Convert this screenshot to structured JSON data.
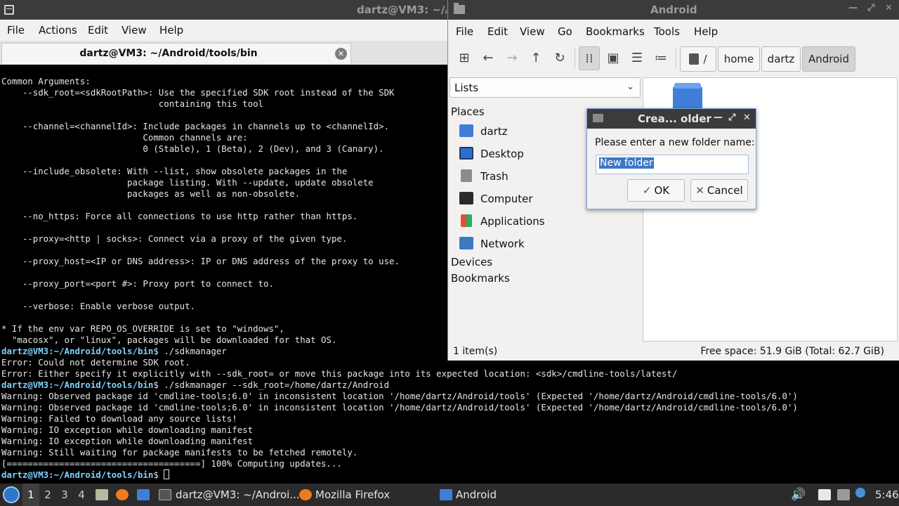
{
  "terminal": {
    "titlebar_title": "dartz@VM3: ~/Android/tools/bin",
    "menu": [
      "File",
      "Actions",
      "Edit",
      "View",
      "Help"
    ],
    "tab_title": "dartz@VM3: ~/Android/tools/bin",
    "prompt_user": "dartz@VM3:",
    "prompt_path": "~/Android/tools/bin",
    "lines_help": [
      "Common Arguments:",
      "    --sdk_root=<sdkRootPath>: Use the specified SDK root instead of the SDK",
      "                              containing this tool",
      "",
      "    --channel=<channelId>: Include packages in channels up to <channelId>.",
      "                           Common channels are:",
      "                           0 (Stable), 1 (Beta), 2 (Dev), and 3 (Canary).",
      "",
      "    --include_obsolete: With --list, show obsolete packages in the",
      "                        package listing. With --update, update obsolete",
      "                        packages as well as non-obsolete.",
      "",
      "    --no_https: Force all connections to use http rather than https.",
      "",
      "    --proxy=<http | socks>: Connect via a proxy of the given type.",
      "",
      "    --proxy_host=<IP or DNS address>: IP or DNS address of the proxy to use.",
      "",
      "    --proxy_port=<port #>: Proxy port to connect to.",
      "",
      "    --verbose: Enable verbose output.",
      "",
      "* If the env var REPO_OS_OVERRIDE is set to \"windows\",",
      "  \"macosx\", or \"linux\", packages will be downloaded for that OS."
    ],
    "cmd1": "$ ./sdkmanager",
    "lines_err": [
      "Error: Could not determine SDK root.",
      "Error: Either specify it explicitly with --sdk_root= or move this package into its expected location: <sdk>/cmdline-tools/latest/"
    ],
    "cmd2": "$ ./sdkmanager --sdk_root=/home/dartz/Android",
    "lines_warn": [
      "Warning: Observed package id 'cmdline-tools;6.0' in inconsistent location '/home/dartz/Android/tools' (Expected '/home/dartz/Android/cmdline-tools/6.0')",
      "Warning: Observed package id 'cmdline-tools;6.0' in inconsistent location '/home/dartz/Android/tools' (Expected '/home/dartz/Android/cmdline-tools/6.0')",
      "Warning: Failed to download any source lists!",
      "Warning: IO exception while downloading manifest",
      "Warning: IO exception while downloading manifest",
      "Warning: Still waiting for package manifests to be fetched remotely.",
      "[=====================================] 100% Computing updates..."
    ],
    "cmd3": "$ "
  },
  "filemanager": {
    "title": "Android",
    "menu": [
      "File",
      "Edit",
      "View",
      "Go",
      "Bookmarks",
      "Tools",
      "Help"
    ],
    "breadcrumbs": [
      "/",
      "home",
      "dartz",
      "Android"
    ],
    "side_combo": "Lists",
    "places_heading": "Places",
    "places": [
      "dartz",
      "Desktop",
      "Trash",
      "Computer",
      "Applications",
      "Network"
    ],
    "devices_heading": "Devices",
    "bookmarks_heading": "Bookmarks",
    "status_left": "1 item(s)",
    "status_right": "Free space: 51.9 GiB (Total: 62.7 GiB)",
    "icon_colors": {
      "folder": "#3f7fd9",
      "home": "#3f7fd9",
      "desktop": "#2c6fd0",
      "trash": "#8c8c8c",
      "computer": "#2a2a2a",
      "network": "#3a7ac0"
    }
  },
  "dialog": {
    "title": "Crea... older",
    "prompt": "Please enter a new folder name:",
    "input_value": "New folder",
    "ok_label": "OK",
    "cancel_label": "Cancel"
  },
  "taskbar": {
    "workspaces": [
      "1",
      "2",
      "3",
      "4"
    ],
    "tasks": [
      "dartz@VM3: ~/Androi...",
      "Mozilla Firefox",
      "Android"
    ],
    "clock": "5:46"
  }
}
